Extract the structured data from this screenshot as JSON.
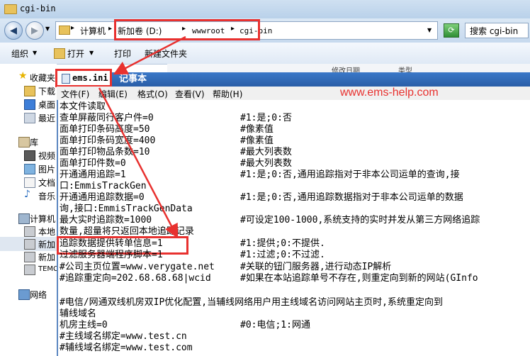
{
  "explorer": {
    "title": "cgi-bin",
    "address": {
      "c1": "计算机",
      "c2": "新加卷 (D:)",
      "c3": "wwwroot",
      "c4": "cgi-bin"
    },
    "search_placeholder": "搜索 cgi-bin",
    "toolbar": {
      "organize": "组织",
      "open": "打开",
      "print": "打印",
      "new_folder": "新建文件夹"
    },
    "nav": [
      {
        "label": "收藏夹"
      },
      {
        "label": "下载"
      },
      {
        "label": "桌面"
      },
      {
        "label": "最近"
      },
      {
        "label": "库"
      },
      {
        "label": "视频"
      },
      {
        "label": "图片"
      },
      {
        "label": "文档"
      },
      {
        "label": "音乐"
      },
      {
        "label": "计算机"
      },
      {
        "label": "本地"
      },
      {
        "label": "新加"
      },
      {
        "label": "新加"
      },
      {
        "label": "TEMC"
      },
      {
        "label": "网络"
      }
    ],
    "column_headers": {
      "c1": "修改日期",
      "c2": "类型"
    }
  },
  "notepad": {
    "filename": "ems.ini",
    "app_name": "记事本",
    "menu": {
      "file": "文件(F)",
      "edit": "编辑(E)",
      "format": "格式(O)",
      "view": "查看(V)",
      "help": "帮助(H)"
    },
    "watermark": "www.ems-help.com",
    "lines": [
      {
        "key": "本文件读取",
        "comment": ""
      },
      {
        "key": "查单屏蔽同行客户件=0",
        "comment": "#1:是;0:否"
      },
      {
        "key": "面单打印条码高度=50",
        "comment": "#像素值"
      },
      {
        "key": "面单打印条码宽度=400",
        "comment": "#像素值"
      },
      {
        "key": "面单打印物品条数=10",
        "comment": "#最大列表数"
      },
      {
        "key": "面单打印件数=0",
        "comment": "#最大列表数"
      },
      {
        "key": "开通通用追踪=1",
        "comment": "#1:是;0:否,通用追踪指对于非本公司运单的查询,接"
      },
      {
        "key": "口:EmmisTrackGen",
        "comment": ""
      },
      {
        "key": "开通通用追踪数据=0",
        "comment": "#1:是;0:否,通用追踪数据指对于非本公司运单的数据"
      },
      {
        "key": "询,接口:EmmisTrackGenData",
        "comment": ""
      },
      {
        "key": "最大实时追踪数=1000",
        "comment": "#可设定100-1000,系统支持的实时并发从第三方网络追踪"
      },
      {
        "key": "数量,超量将只返回本地追踪记录",
        "comment": ""
      },
      {
        "key": "追踪数据提供转单信息=1",
        "comment": "#1:提供;0:不提供."
      },
      {
        "key": "过滤服务器端程序脚本=1",
        "comment": "#1:过滤;0:不过滤."
      },
      {
        "key": "#公司主页位置=www.verygate.net",
        "comment": "#关联的钮门服务器,进行动态IP解析"
      },
      {
        "key": "#追踪重定向=202.68.68.68|wcid",
        "comment": "#如果在本站追踪单号不存在,则重定向到新的网站(GInfo"
      },
      {
        "key": "",
        "comment": ""
      },
      {
        "key": "#电信/网通双线机房双IP优化配置,当辅线网络用户用主线域名访问网站主页时,系统重定向到",
        "comment": ""
      },
      {
        "key": "辅线域名",
        "comment": ""
      },
      {
        "key": "机房主线=0",
        "comment": "#0:电信;1:网通"
      },
      {
        "key": "#主线域名绑定=www.test.cn",
        "comment": ""
      },
      {
        "key": "#辅线域名绑定=www.test.com",
        "comment": ""
      }
    ]
  },
  "colors": {
    "annotation_red": "#e8312f",
    "notepad_title_blue": "#2a5ea7"
  }
}
